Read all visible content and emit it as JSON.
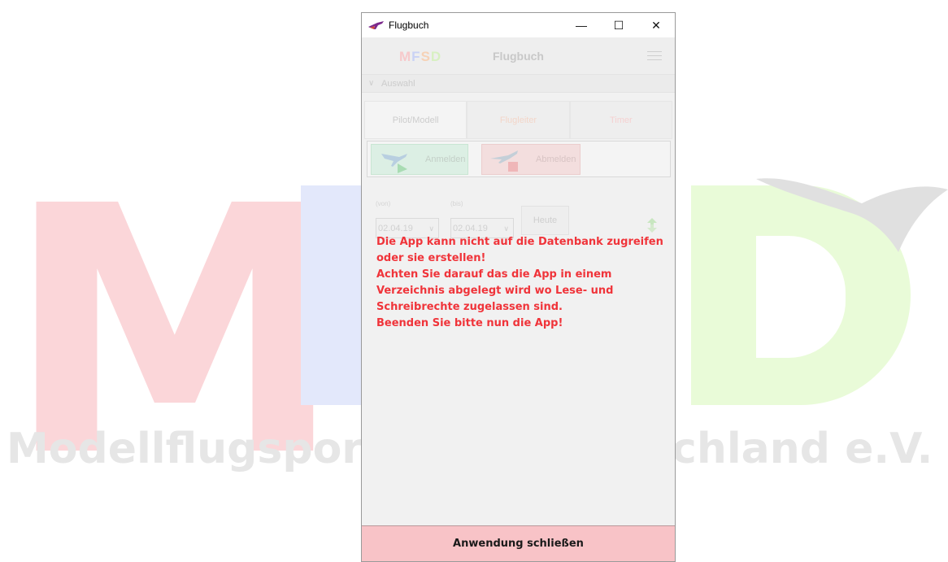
{
  "background": {
    "subtitle_left": "Modellflugsport",
    "subtitle_right": "chland e.V."
  },
  "window": {
    "title": "Flugbuch",
    "controls": {
      "minimize": "—",
      "maximize": "☐",
      "close": "✕"
    }
  },
  "app": {
    "logo": {
      "m": "M",
      "f": "F",
      "s": "S",
      "d": "D"
    },
    "header_title": "Flugbuch",
    "section": {
      "label": "Auswahl"
    },
    "tabs": [
      {
        "label": "Pilot/Modell"
      },
      {
        "label": "Flugleiter"
      },
      {
        "label": "Timer"
      }
    ],
    "buttons": {
      "anmelden": "Anmelden",
      "abmelden": "Abmelden"
    },
    "filter": {
      "von_label": "(von)",
      "von_value": "02.04.19",
      "bis_label": "(bis)",
      "bis_value": "02.04.19",
      "heute": "Heute"
    },
    "error_lines": [
      "Die App kann nicht auf die Datenbank zugreifen",
      "oder sie erstellen!",
      "Achten Sie darauf das die App in einem",
      "Verzeichnis abgelegt wird wo Lese- und",
      "Schreibrechte zugelassen sind.",
      "Beenden Sie bitte nun die App!"
    ],
    "close_button": "Anwendung schließen"
  },
  "colors": {
    "error_text": "#f0343a",
    "close_button_bg": "#f8c3c7",
    "logo_m": "#fbd6d9",
    "logo_f": "#e3e8fb",
    "logo_d": "#e9fbd8"
  }
}
